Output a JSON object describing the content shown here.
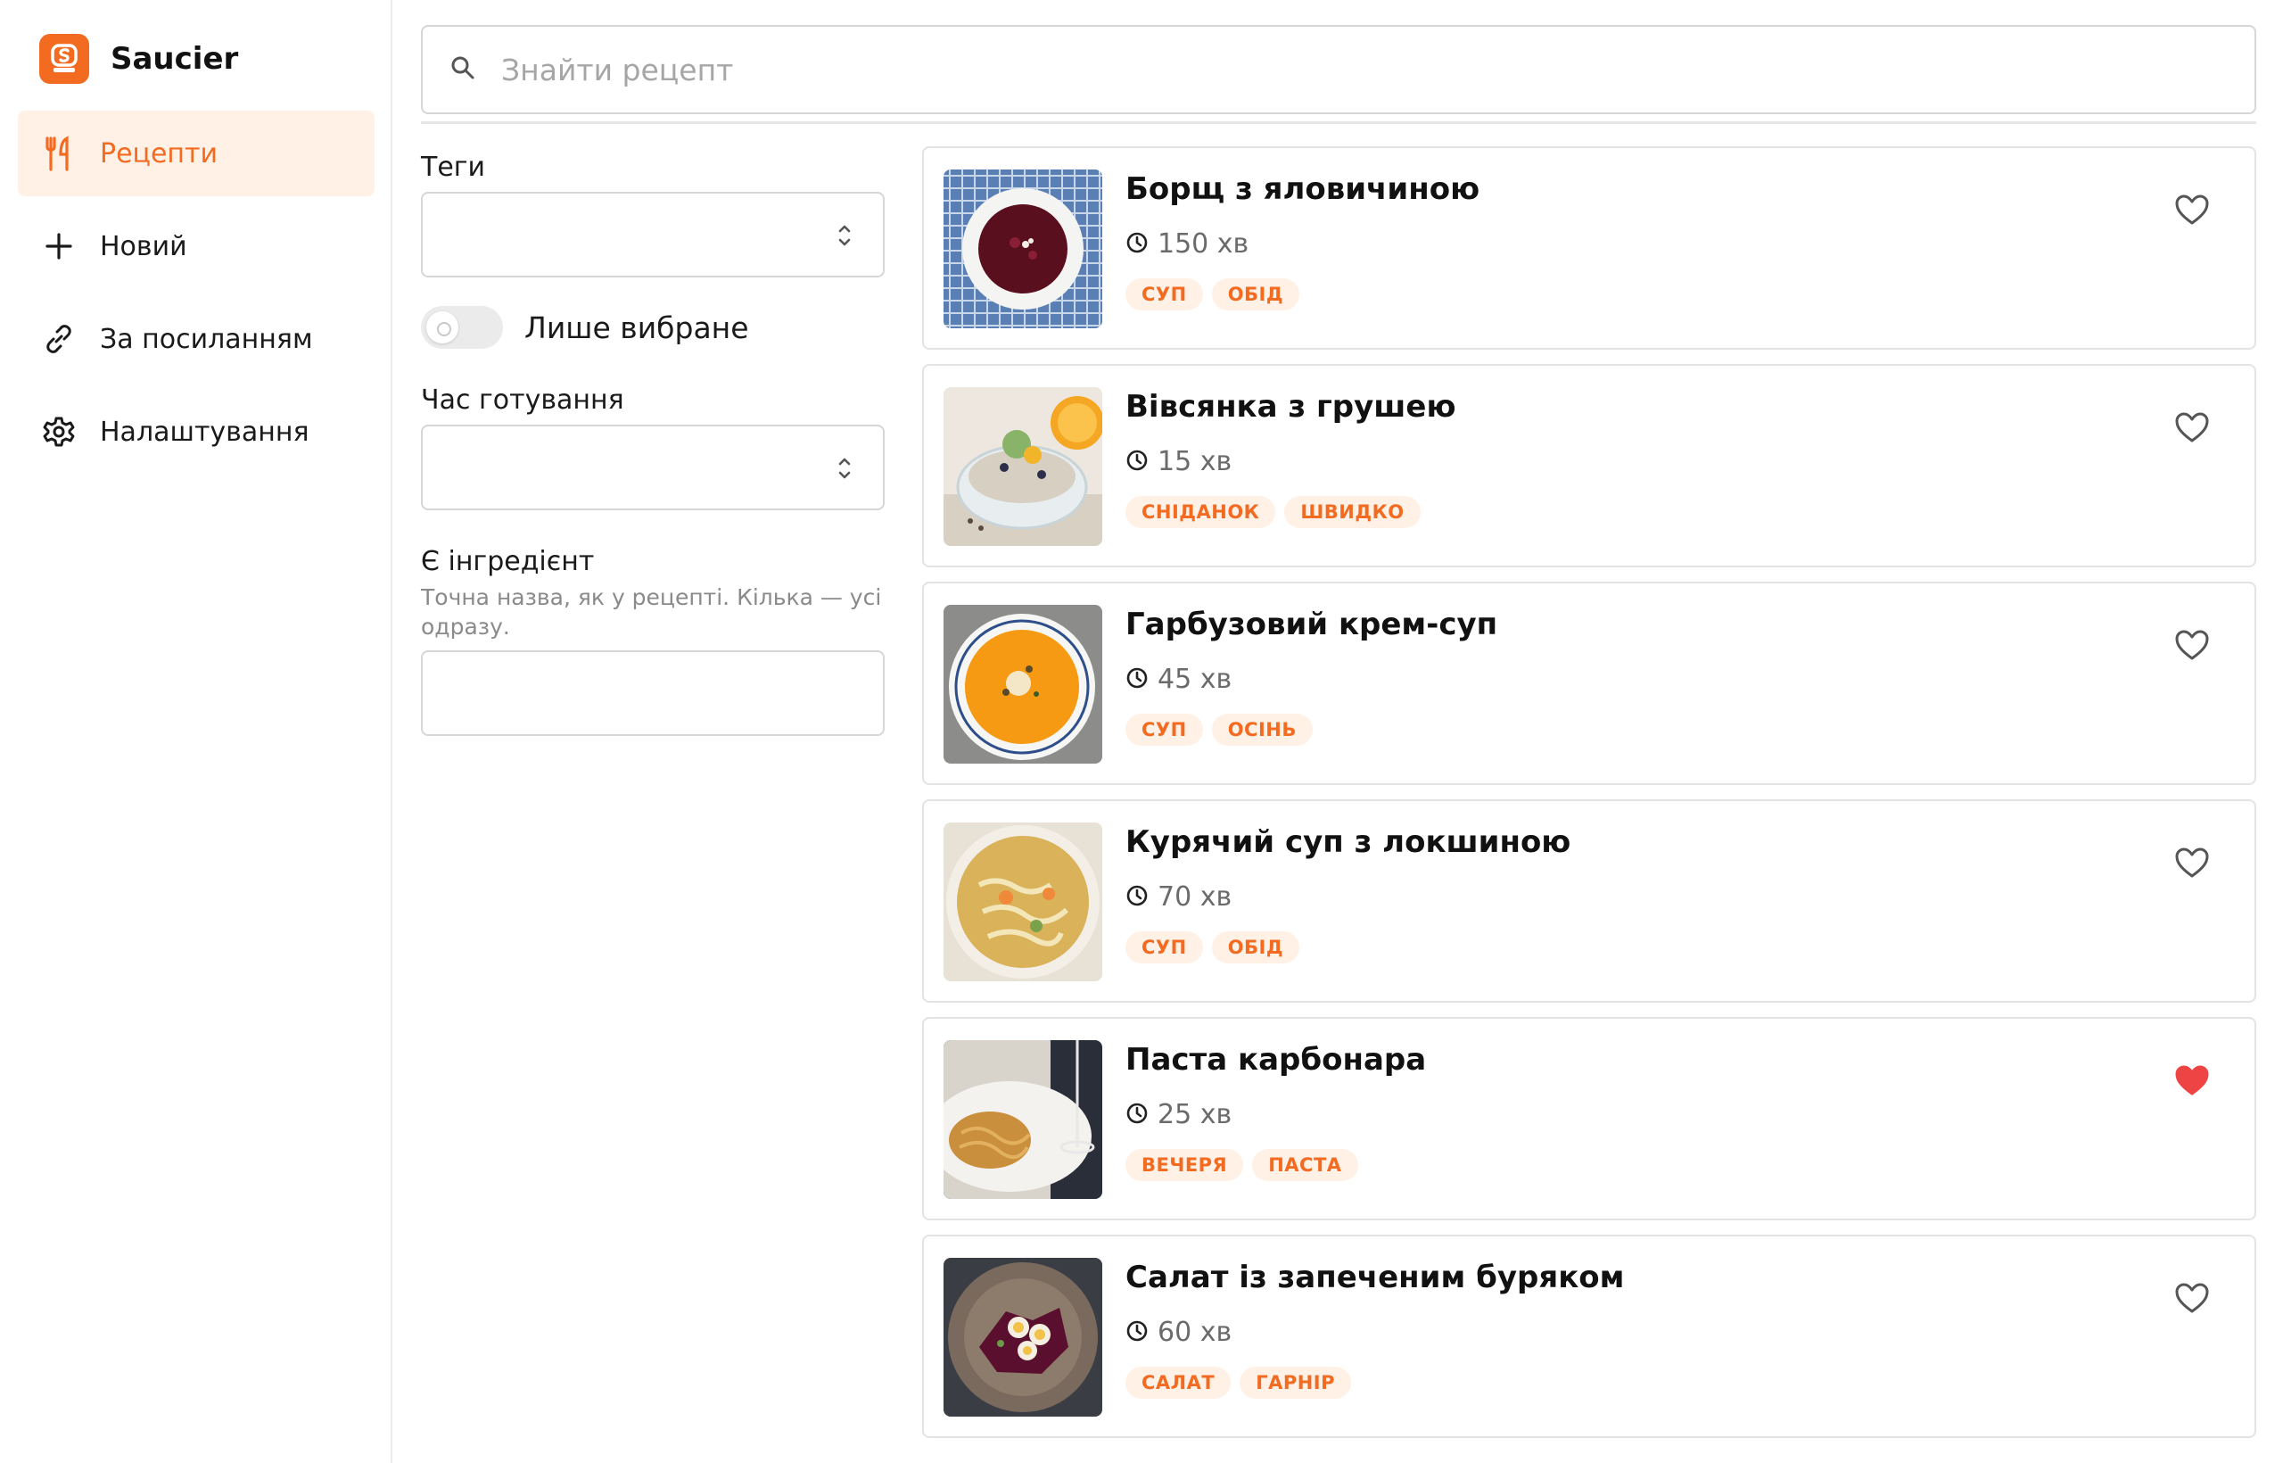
{
  "app": {
    "name": "Saucier"
  },
  "nav": [
    {
      "label": "Рецепти",
      "icon": "utensils-icon",
      "active": true
    },
    {
      "label": "Новий",
      "icon": "plus-icon",
      "active": false
    },
    {
      "label": "За посиланням",
      "icon": "link-icon",
      "active": false
    },
    {
      "label": "Налаштування",
      "icon": "gear-icon",
      "active": false
    }
  ],
  "search": {
    "placeholder": "Знайти рецепт",
    "value": ""
  },
  "filters": {
    "tags_label": "Теги",
    "tags_value": "",
    "favorites_label": "Лише вибране",
    "favorites_on": false,
    "time_label": "Час готування",
    "time_value": "",
    "ingredient_label": "Є інгредієнт",
    "ingredient_hint": "Точна назва, як у рецепті. Кілька — усі одразу.",
    "ingredient_value": ""
  },
  "recipes": [
    {
      "title": "Борщ з яловичиною",
      "time": "150 хв",
      "tags": [
        "СУП",
        "ОБІД"
      ],
      "favorite": false
    },
    {
      "title": "Вівсянка з грушею",
      "time": "15 хв",
      "tags": [
        "СНІДАНОК",
        "ШВИДКО"
      ],
      "favorite": false
    },
    {
      "title": "Гарбузовий крем-суп",
      "time": "45 хв",
      "tags": [
        "СУП",
        "ОСІНЬ"
      ],
      "favorite": false
    },
    {
      "title": "Курячий суп з локшиною",
      "time": "70 хв",
      "tags": [
        "СУП",
        "ОБІД"
      ],
      "favorite": false
    },
    {
      "title": "Паста карбонара",
      "time": "25 хв",
      "tags": [
        "ВЕЧЕРЯ",
        "ПАСТА"
      ],
      "favorite": true
    },
    {
      "title": "Салат із запеченим буряком",
      "time": "60 хв",
      "tags": [
        "САЛАТ",
        "ГАРНІР"
      ],
      "favorite": false
    }
  ],
  "colors": {
    "accent": "#f26b21",
    "accent_soft": "#fff1e6",
    "favorite": "#ef4444"
  }
}
